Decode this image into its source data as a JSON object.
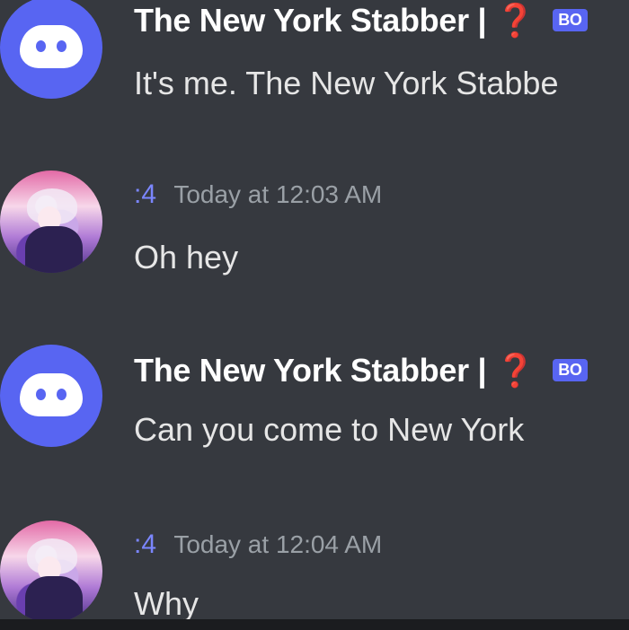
{
  "messages": [
    {
      "avatar": "discord-logo-icon",
      "author": "The New York Stabber | ❓",
      "badge": "BO",
      "text": "It's me. The New York Stabbe"
    },
    {
      "avatar": "anime-avatar",
      "author": ":4",
      "timestamp": "Today at 12:03 AM",
      "text": "Oh hey"
    },
    {
      "avatar": "discord-logo-icon",
      "author": "The New York Stabber | ❓",
      "badge": "BO",
      "text": "Can you come to New York"
    },
    {
      "avatar": "anime-avatar",
      "author": ":4",
      "timestamp": "Today at 12:04 AM",
      "text": "Why"
    }
  ],
  "colors": {
    "background": "#36393f",
    "blurple": "#5865f2",
    "username": "#7b86ff",
    "timestamp": "#9aa0a6",
    "text": "#e6e6e6"
  }
}
